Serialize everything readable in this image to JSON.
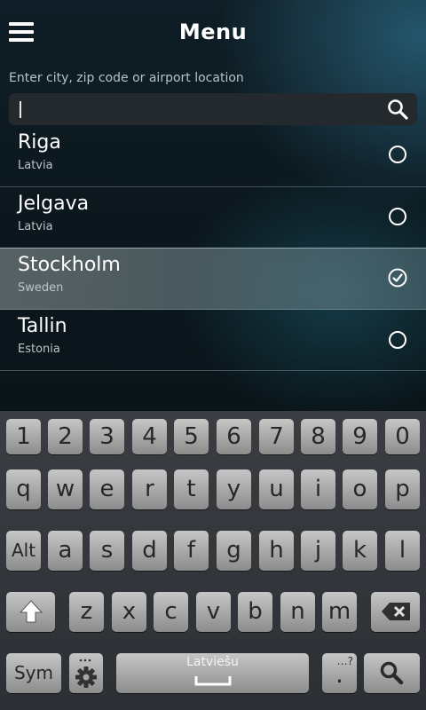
{
  "header": {
    "title": "Menu"
  },
  "search": {
    "label": "Enter city, zip code or airport location",
    "value": ""
  },
  "locations": [
    {
      "city": "Riga",
      "country": "Latvia",
      "selected": false
    },
    {
      "city": "Jelgava",
      "country": "Latvia",
      "selected": false
    },
    {
      "city": "Stockholm",
      "country": "Sweden",
      "selected": true
    },
    {
      "city": "Tallin",
      "country": "Estonia",
      "selected": false
    }
  ],
  "keyboard": {
    "numbers": [
      "1",
      "2",
      "3",
      "4",
      "5",
      "6",
      "7",
      "8",
      "9",
      "0"
    ],
    "row1": [
      "q",
      "w",
      "e",
      "r",
      "t",
      "y",
      "u",
      "i",
      "o",
      "p"
    ],
    "row2": [
      "a",
      "s",
      "d",
      "f",
      "g",
      "h",
      "j",
      "k",
      "l"
    ],
    "row3": [
      "z",
      "x",
      "c",
      "v",
      "b",
      "n",
      "m"
    ],
    "alt_label": "Alt",
    "sym_label": "Sym",
    "space_label": "Latviešu",
    "period_label": ".",
    "period_extra": "…?"
  }
}
